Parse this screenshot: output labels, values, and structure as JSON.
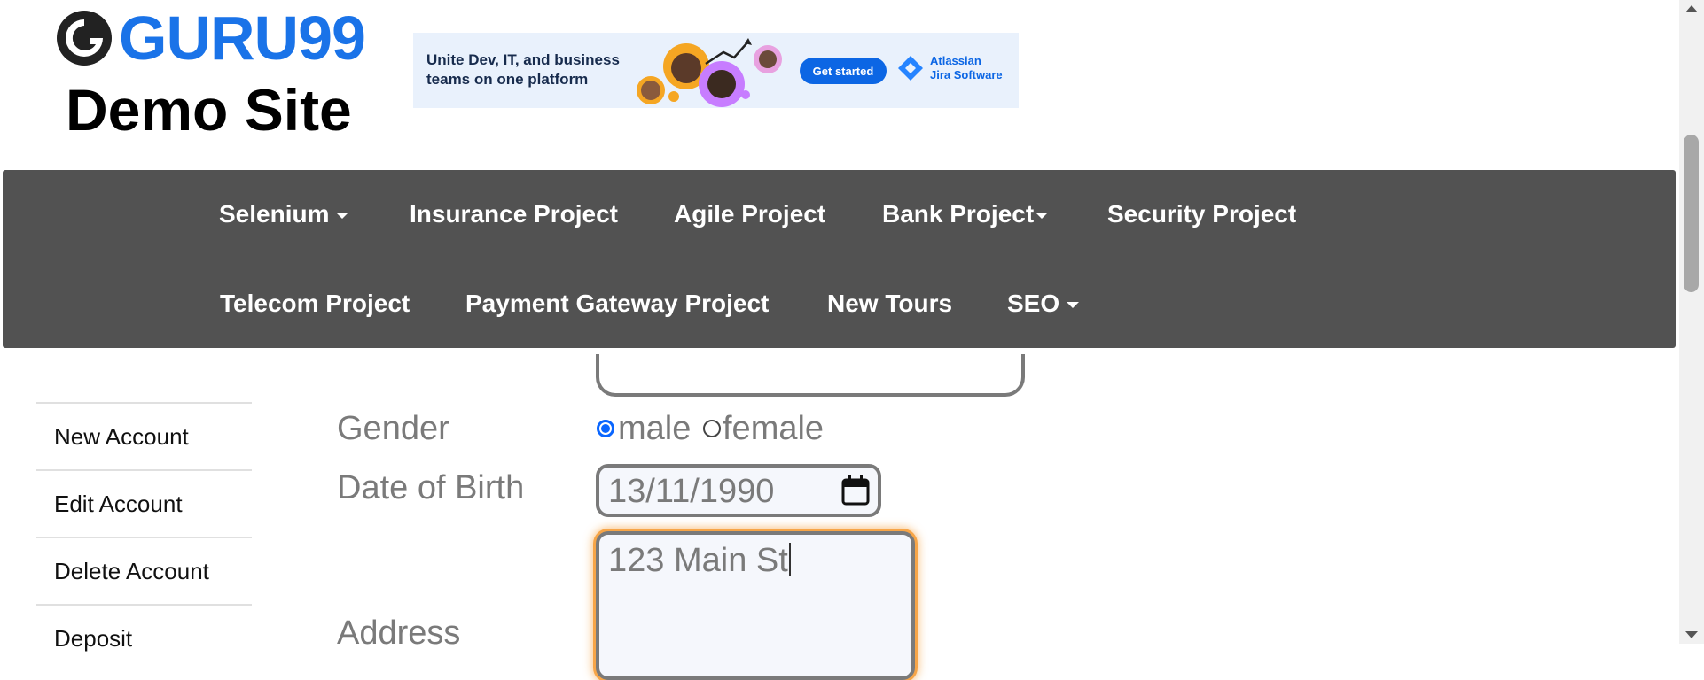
{
  "header": {
    "logo_text": "GURU99",
    "site_title": "Demo Site"
  },
  "ad": {
    "headline": "Unite Dev, IT, and business teams on one platform",
    "button": "Get started",
    "brand_line1": "Atlassian",
    "brand_line2": "Jira Software"
  },
  "nav": {
    "row1": [
      "Selenium",
      "Insurance Project",
      "Agile Project",
      "Bank Project",
      "Security Project"
    ],
    "row2": [
      "Telecom Project",
      "Payment Gateway Project",
      "New Tours",
      "SEO"
    ]
  },
  "sidebar": {
    "items": [
      "New Account",
      "Edit Account",
      "Delete Account",
      "Deposit"
    ]
  },
  "form": {
    "gender_label": "Gender",
    "gender_options": [
      "male",
      "female"
    ],
    "gender_selected": "male",
    "dob_label": "Date of Birth",
    "dob_value": "13/11/1990",
    "address_label": "Address",
    "address_value": "123 Main St"
  },
  "colors": {
    "brand_blue": "#1a73e8",
    "nav_bg": "#525252",
    "focus_orange": "#f7a547",
    "radio_blue": "#0a66ff"
  }
}
